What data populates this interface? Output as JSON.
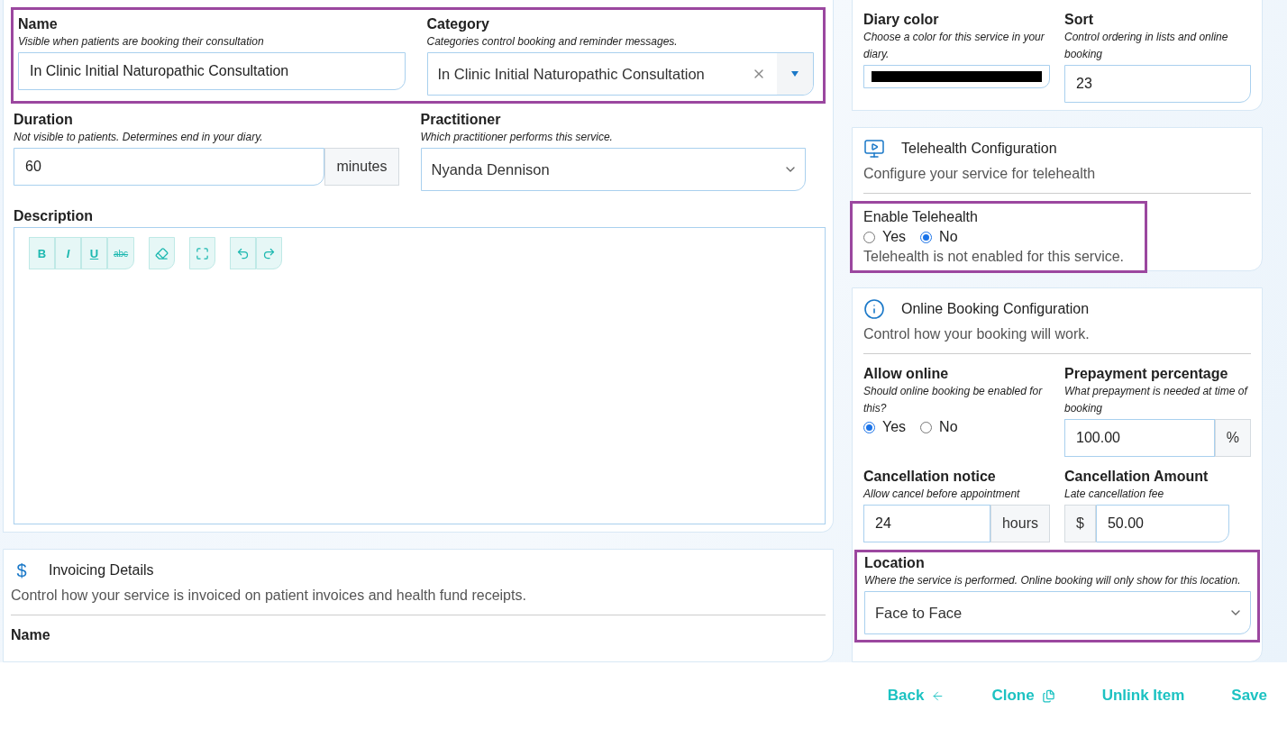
{
  "service_form": {
    "highlighted": true,
    "name": {
      "label": "Name",
      "hint": "Visible when patients are booking their consultation",
      "value": "In Clinic Initial Naturopathic Consultation"
    },
    "category": {
      "label": "Category",
      "hint": "Categories control booking and reminder messages.",
      "value": "In Clinic Initial Naturopathic Consultation"
    },
    "duration": {
      "label": "Duration",
      "hint": "Not visible to patients. Determines end in your diary.",
      "value": "60",
      "unit": "minutes"
    },
    "practitioner": {
      "label": "Practitioner",
      "hint": "Which practitioner performs this service.",
      "value": "Nyanda Dennison"
    },
    "description": {
      "label": "Description",
      "toolbar": [
        {
          "buttons": [
            {
              "kind": "bold",
              "label": "B"
            },
            {
              "kind": "italic",
              "label": "I"
            },
            {
              "kind": "underline",
              "label": "U"
            },
            {
              "kind": "strike",
              "label": "abc"
            }
          ]
        },
        {
          "buttons": [
            {
              "kind": "eraser"
            }
          ]
        },
        {
          "buttons": [
            {
              "kind": "fullscreen"
            }
          ]
        },
        {
          "buttons": [
            {
              "kind": "undo"
            },
            {
              "kind": "redo"
            }
          ]
        }
      ]
    }
  },
  "invoicing": {
    "symbol": "$",
    "title": "Invoicing Details",
    "description": "Control how your service is invoiced on patient invoices and health fund receipts.",
    "field_label": "Name"
  },
  "settings": {
    "diary_color": {
      "label": "Diary color",
      "hint": "Choose a color for this service in your diary.",
      "color": "#000000"
    },
    "sort": {
      "label": "Sort",
      "hint": "Control ordering in lists and online booking",
      "value": "23"
    },
    "telehealth": {
      "title": "Telehealth Configuration",
      "subtitle": "Configure your service for telehealth",
      "highlighted": true,
      "label": "Enable Telehealth",
      "options": [
        {
          "label": "Yes",
          "selected": false
        },
        {
          "label": "No",
          "selected": true
        }
      ],
      "note": "Telehealth is not enabled for this service."
    },
    "online_booking": {
      "title": "Online Booking Configuration",
      "subtitle": "Control how your booking will work.",
      "allow_online": {
        "label": "Allow online",
        "hint": "Should online booking be enabled for this?",
        "options": [
          {
            "label": "Yes",
            "selected": true
          },
          {
            "label": "No",
            "selected": false
          }
        ]
      },
      "prepayment": {
        "label": "Prepayment percentage",
        "hint": "What prepayment is needed at time of booking",
        "value": "100.00",
        "unit": "%"
      },
      "cancellation_notice": {
        "label": "Cancellation notice",
        "hint": "Allow cancel before appointment",
        "value": "24",
        "unit": "hours"
      },
      "cancellation_amount": {
        "label": "Cancellation Amount",
        "hint": "Late cancellation fee",
        "prefix": "$",
        "value": "50.00"
      },
      "location": {
        "highlighted": true,
        "label": "Location",
        "hint": "Where the service is performed. Online booking will only show for this location.",
        "value": "Face to Face"
      }
    }
  },
  "actions": [
    {
      "label": "Back",
      "kind": "back"
    },
    {
      "label": "Clone",
      "kind": "clone"
    },
    {
      "label": "Unlink Item",
      "kind": "plain"
    },
    {
      "label": "Save",
      "kind": "plain"
    }
  ]
}
